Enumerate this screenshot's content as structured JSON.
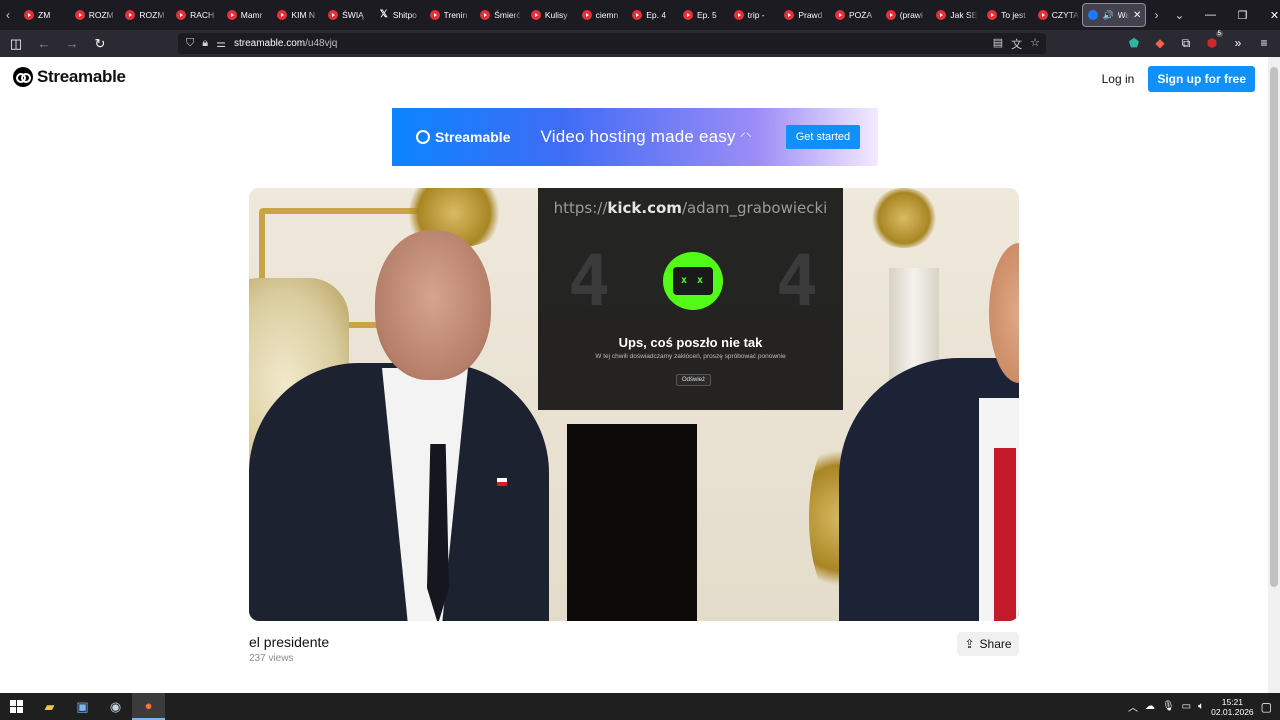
{
  "browser": {
    "tabs": [
      {
        "label": "ZM",
        "icon": "play-icon"
      },
      {
        "label": "ROZM",
        "icon": "play-icon"
      },
      {
        "label": "ROZM",
        "icon": "play-icon"
      },
      {
        "label": "RACH",
        "icon": "play-icon"
      },
      {
        "label": "Mamr",
        "icon": "play-icon"
      },
      {
        "label": "KIM N",
        "icon": "play-icon"
      },
      {
        "label": "ŚWIĄ",
        "icon": "play-icon"
      },
      {
        "label": "Shitpo",
        "icon": "x-icon"
      },
      {
        "label": "Trenin",
        "icon": "play-icon"
      },
      {
        "label": "Śmierć",
        "icon": "play-icon"
      },
      {
        "label": "Kulisy",
        "icon": "play-icon"
      },
      {
        "label": "ciemn",
        "icon": "play-icon"
      },
      {
        "label": "Ep. 4",
        "icon": "play-icon"
      },
      {
        "label": "Ep. 5",
        "icon": "play-icon"
      },
      {
        "label": "trip -",
        "icon": "play-icon"
      },
      {
        "label": "Prawd",
        "icon": "play-icon"
      },
      {
        "label": "POŻA",
        "icon": "play-icon"
      },
      {
        "label": "(prawi",
        "icon": "play-icon"
      },
      {
        "label": "Jak SE",
        "icon": "play-icon"
      },
      {
        "label": "To jest",
        "icon": "play-icon"
      },
      {
        "label": "CZYTA",
        "icon": "play-icon"
      }
    ],
    "active_tab": {
      "label": "Wa",
      "icon": "streamable-icon"
    },
    "url": {
      "domain": "streamable.com",
      "path": "/u48vjq"
    },
    "ext_badge": "5"
  },
  "site": {
    "logo_text": "Streamable",
    "login": "Log in",
    "signup": "Sign up for free"
  },
  "banner": {
    "logo_text": "Streamable",
    "tagline": "Video hosting made easy",
    "cta": "Get started"
  },
  "video": {
    "overlay_url_prefix": "https://",
    "overlay_url_domain": "kick.com",
    "overlay_url_path": "/adam_grabowiecki",
    "error_digit": "4",
    "error_face": "x x",
    "error_title": "Ups, coś poszło nie tak",
    "error_subtitle": "W tej chwili doświadczamy zakłóceń, proszę spróbować ponownie",
    "error_button": "Odśwież",
    "title": "el presidente",
    "views": "237 views",
    "share": "Share"
  },
  "taskbar": {
    "time": "15:21",
    "date": "02.01.2026"
  }
}
